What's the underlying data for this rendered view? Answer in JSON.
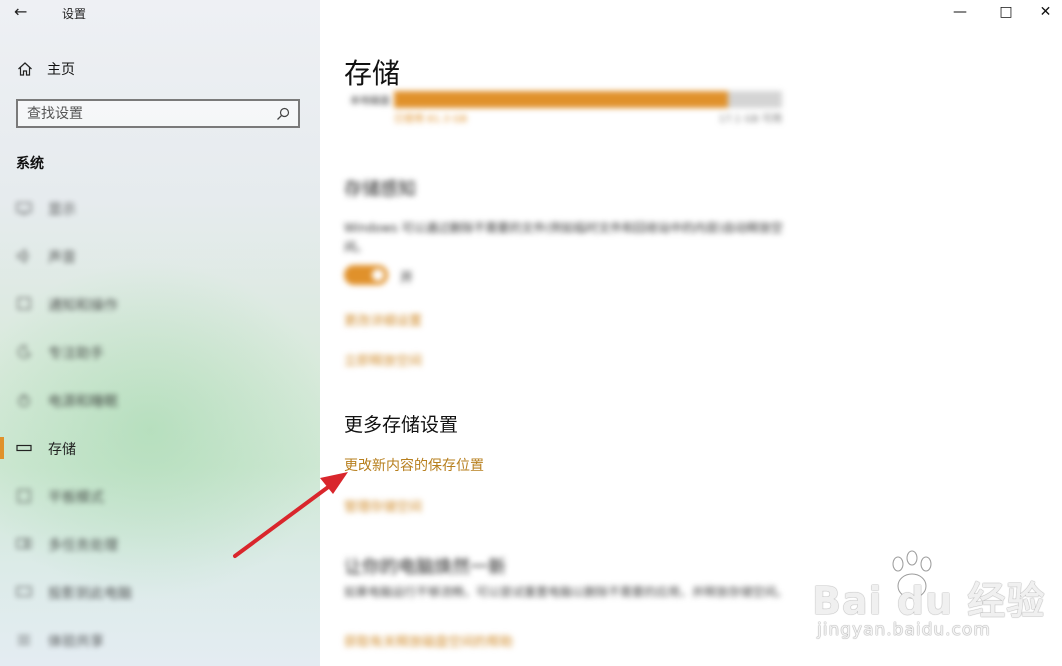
{
  "window": {
    "title": "设置",
    "back_icon": "back-arrow-icon",
    "minimize_icon": "minimize-icon",
    "maximize_icon": "maximize-icon",
    "close_icon": "close-icon"
  },
  "sidebar": {
    "home_label": "主页",
    "search_placeholder": "查找设置",
    "section_header": "系统",
    "items": [
      {
        "label": "显示",
        "icon": "display-icon",
        "blurred": true
      },
      {
        "label": "声音",
        "icon": "sound-icon",
        "blurred": true
      },
      {
        "label": "通知和操作",
        "icon": "notifications-icon",
        "blurred": true
      },
      {
        "label": "专注助手",
        "icon": "focus-assist-icon",
        "blurred": true
      },
      {
        "label": "电源和睡眠",
        "icon": "power-icon",
        "blurred": true
      },
      {
        "label": "存储",
        "icon": "storage-icon",
        "blurred": false,
        "active": true
      },
      {
        "label": "平板模式",
        "icon": "tablet-icon",
        "blurred": true
      },
      {
        "label": "多任务处理",
        "icon": "multitasking-icon",
        "blurred": true
      },
      {
        "label": "投影到此电脑",
        "icon": "project-icon",
        "blurred": true
      },
      {
        "label": "体验共享",
        "icon": "shared-icon",
        "blurred": true
      }
    ]
  },
  "main": {
    "page_title": "存储",
    "drive": {
      "name": "本地磁盘 (C:)",
      "used_text": "已使用 81.3 GB",
      "free_text": "17.1 GB 可用",
      "used_fraction": 0.86
    },
    "storage_sense": {
      "header": "存储感知",
      "description": "Windows 可以通过删除不需要的文件(例如临时文件和回收站中的内容)自动释放空间。",
      "toggle_state": "开",
      "links": [
        "更改详细设置",
        "立即释放空间"
      ]
    },
    "more_settings": {
      "header": "更多存储设置",
      "link_change_save_location": "更改新内容的保存位置",
      "link_manage_spaces": "管理存储空间"
    },
    "section2": {
      "header": "让你的电脑焕然一新",
      "description": "如果电脑运行不够流畅，可以尝试重置电脑以删除不需要的应用，并释放存储空间。",
      "link": "获取有关释放磁盘空间的帮助"
    }
  },
  "accent_color": "#e0912b",
  "watermark": {
    "logo": "Bai du 经验",
    "url": "jingyan.baidu.com"
  }
}
